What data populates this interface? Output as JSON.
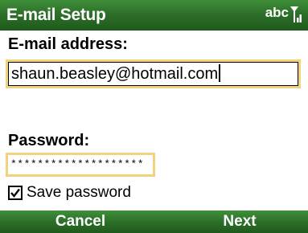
{
  "titlebar": {
    "title": "E-mail Setup",
    "input_mode": "abc",
    "signal_icon": "signal-strength-icon"
  },
  "form": {
    "email_label": "E-mail address:",
    "email_value": "shaun.beasley@hotmail.com",
    "password_label": "Password:",
    "password_value": "********************",
    "save_password_label": "Save password",
    "save_password_checked": true
  },
  "softkeys": {
    "left": "Cancel",
    "right": "Next"
  },
  "colors": {
    "bar_green": "#2d6f29",
    "focus_border": "#f2d27a"
  }
}
